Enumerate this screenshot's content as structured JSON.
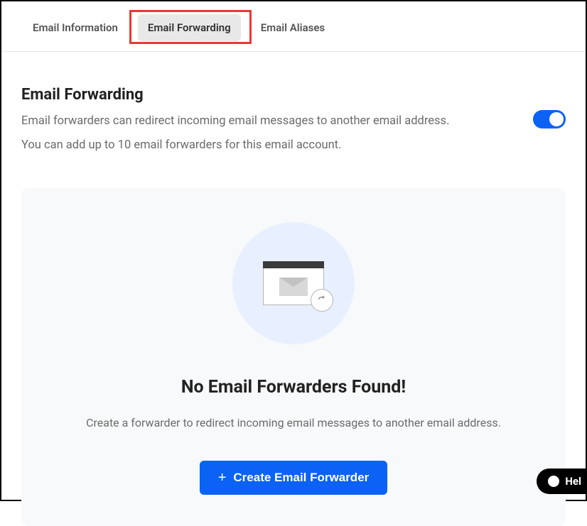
{
  "tabs": {
    "info": "Email Information",
    "forwarding": "Email Forwarding",
    "aliases": "Email Aliases"
  },
  "page": {
    "title": "Email Forwarding",
    "desc1": "Email forwarders can redirect incoming email messages to another email address.",
    "desc2": "You can add up to 10 email forwarders for this email account."
  },
  "empty": {
    "title": "No Email Forwarders Found!",
    "desc": "Create a forwarder to redirect incoming email messages to another email address.",
    "button": "Create Email Forwarder"
  },
  "help": {
    "label": "Hel"
  }
}
